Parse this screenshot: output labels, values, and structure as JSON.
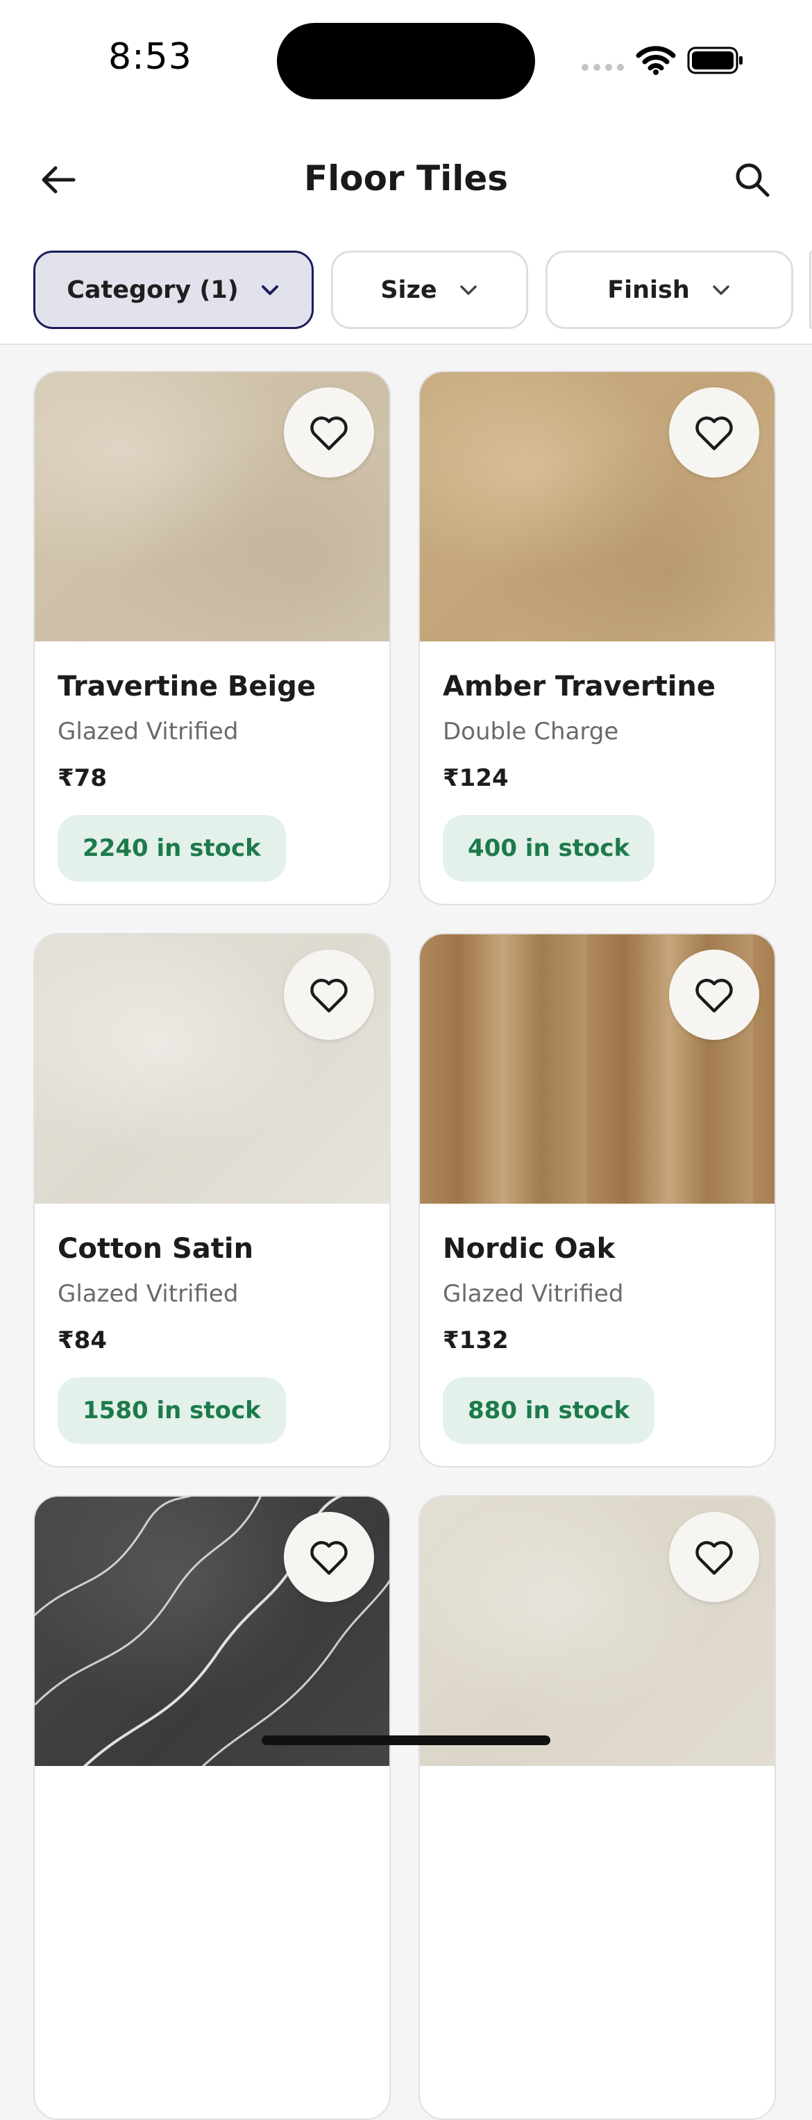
{
  "status_bar": {
    "time": "8:53"
  },
  "header": {
    "title": "Floor Tiles",
    "back_icon": "arrow-left-icon",
    "search_icon": "search-icon"
  },
  "filters": [
    {
      "label": "Category (1)",
      "active": true
    },
    {
      "label": "Size",
      "active": false
    },
    {
      "label": "Finish",
      "active": false
    }
  ],
  "colors": {
    "chip_active_bg": "#e1e2ec",
    "chip_active_border": "#1b1d5c",
    "stock_bg": "#e3f1ea",
    "stock_text": "#1d7a4c"
  },
  "products": [
    {
      "name": "Travertine Beige",
      "finish": "Glazed Vitrified",
      "price": "₹78",
      "stock": "2240 in stock"
    },
    {
      "name": "Amber Travertine",
      "finish": "Double Charge",
      "price": "₹124",
      "stock": "400 in stock"
    },
    {
      "name": "Cotton Satin",
      "finish": "Glazed Vitrified",
      "price": "₹84",
      "stock": "1580 in stock"
    },
    {
      "name": "Nordic Oak",
      "finish": "Glazed Vitrified",
      "price": "₹132",
      "stock": "880 in stock"
    }
  ]
}
